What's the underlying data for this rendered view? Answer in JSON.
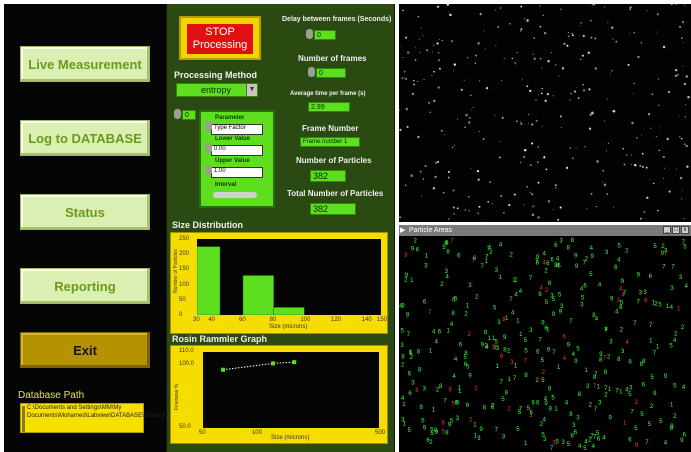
{
  "nav": {
    "live_measurement": "Live Measurement",
    "log_to_database": "Log to DATABASE",
    "status": "Status",
    "reporting": "Reporting",
    "exit": "Exit"
  },
  "database_path": {
    "label": "Database Path",
    "value": "C:\\Documents and Settings\\MM\\My Documents\\Mohamed\\Labview\\DATABASE\\Size.udl"
  },
  "processing": {
    "stop_button": "STOP Processing",
    "method_label": "Processing Method",
    "method_value": "entropy",
    "method_spinner_value": "0",
    "parameter_label": "Parameter",
    "parameter_value": "Type Factor",
    "lower_value_label": "Lower Value",
    "lower_value": "0.00",
    "upper_value_label": "Upper Value",
    "upper_value": "1.00",
    "interval_label": "Interval"
  },
  "stats": {
    "delay_label": "Delay between frames (Seconds)",
    "delay_value": "0",
    "num_frames_label": "Number of frames",
    "num_frames_value": "0",
    "avg_time_label": "Average time per frame (s)",
    "avg_time_value": "2.99",
    "frame_number_label": "Frame Number",
    "frame_number_value": "Frame number 1",
    "num_particles_label": "Number of Particles",
    "num_particles_value": "382",
    "total_particles_label": "Total Number of Particles",
    "total_particles_value": "382"
  },
  "size_distribution": {
    "title": "Size Distribution",
    "ylabel": "Number of Particles",
    "xlabel": "Size (microns)",
    "y_ticks": [
      "250",
      "200",
      "150",
      "100",
      "50",
      "0"
    ],
    "x_ticks": [
      "30",
      "40",
      "60",
      "80",
      "100",
      "120",
      "140",
      "150"
    ]
  },
  "rosin_rammler": {
    "title": "Rosin Rammler Graph",
    "ylabel": "Fineness %",
    "xlabel": "Size (microns)",
    "y_ticks": [
      "110.0",
      "100.0",
      "50.0"
    ],
    "x_ticks": [
      "50",
      "100",
      "500"
    ]
  },
  "particle_window": {
    "title": "Particle Areas",
    "controls": [
      "_",
      "□",
      "x"
    ]
  },
  "chart_data": [
    {
      "type": "bar",
      "title": "Size Distribution",
      "xlabel": "Size (microns)",
      "ylabel": "Number of Particles",
      "x_bins": [
        [
          30,
          45
        ],
        [
          60,
          80
        ],
        [
          80,
          100
        ]
      ],
      "values": [
        225,
        130,
        25
      ],
      "xlim": [
        30,
        150
      ],
      "ylim": [
        0,
        250
      ]
    },
    {
      "type": "line",
      "title": "Rosin Rammler Graph",
      "xlabel": "Size (microns)",
      "ylabel": "Fineness %",
      "x": [
        65,
        125,
        165
      ],
      "y": [
        96,
        101,
        102
      ],
      "xlim": [
        50,
        500
      ],
      "ylim": [
        50,
        110
      ]
    }
  ],
  "colors": {
    "left_bg": "#050505",
    "panel_bg": "#2b4a12",
    "accent_green": "#5dde1e",
    "accent_yellow": "#f6dd00",
    "stop_red": "#e01010"
  }
}
